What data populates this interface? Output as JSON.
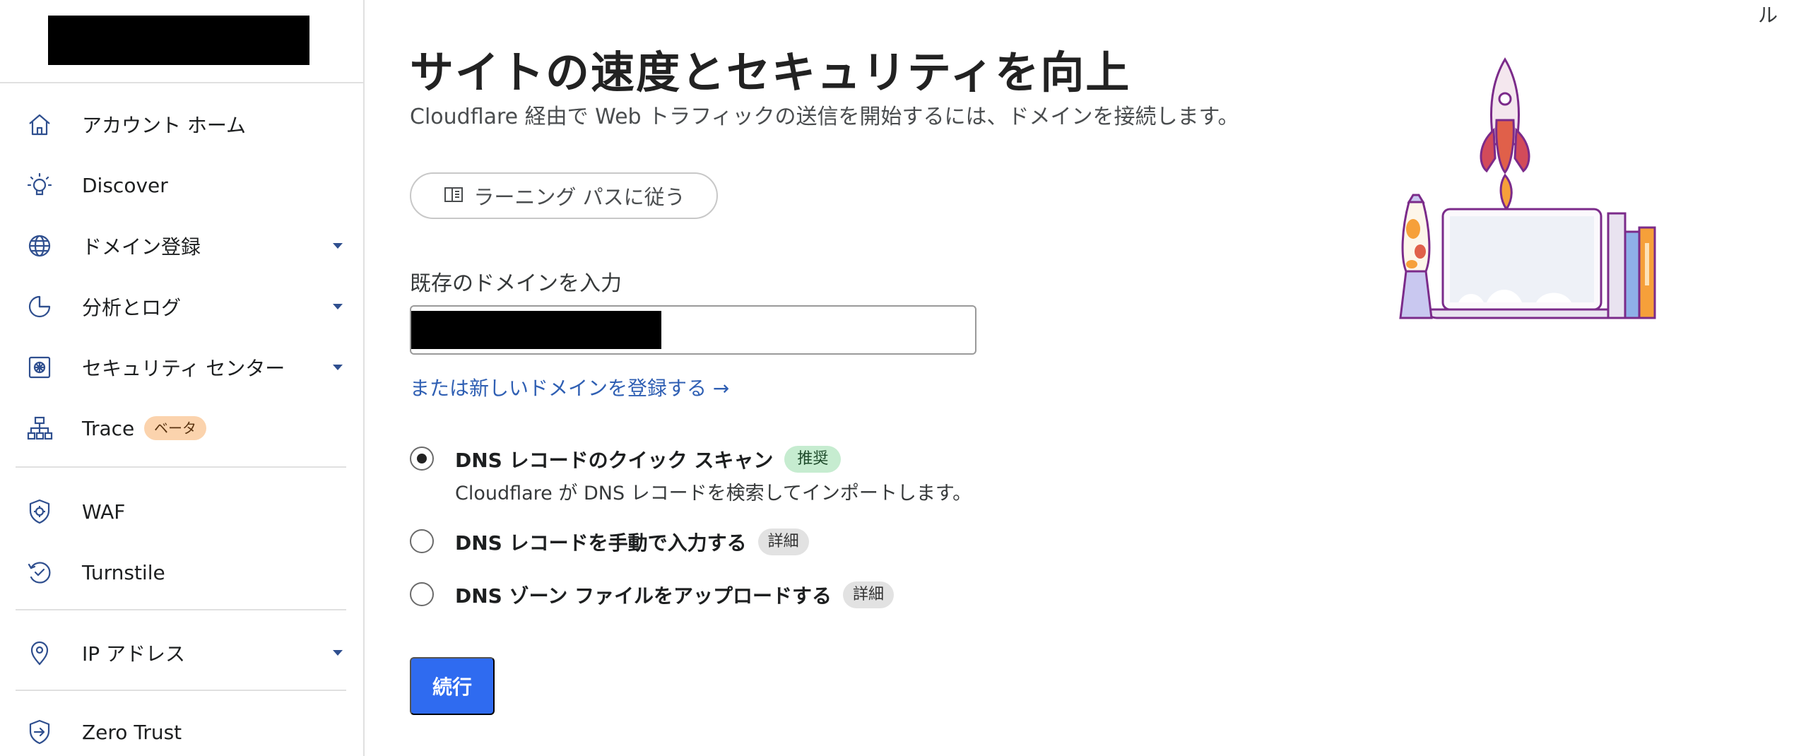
{
  "sidebar": {
    "items": [
      {
        "label": "アカウント ホーム",
        "icon": "home-icon"
      },
      {
        "label": "Discover",
        "icon": "lightbulb-icon"
      },
      {
        "label": "ドメイン登録",
        "icon": "globe-icon",
        "expandable": true
      },
      {
        "label": "分析とログ",
        "icon": "pie-chart-icon",
        "expandable": true
      },
      {
        "label": "セキュリティ センター",
        "icon": "security-center-icon",
        "expandable": true
      },
      {
        "label": "Trace",
        "icon": "sitemap-icon",
        "badge": "ベータ"
      },
      {
        "label": "WAF",
        "icon": "shield-gear-icon"
      },
      {
        "label": "Turnstile",
        "icon": "turnstile-icon"
      },
      {
        "label": "IP アドレス",
        "icon": "location-pin-icon",
        "expandable": true
      },
      {
        "label": "Zero Trust",
        "icon": "zero-trust-icon"
      }
    ]
  },
  "header": {
    "corner_text": "ル"
  },
  "main": {
    "title": "サイトの速度とセキュリティを向上",
    "description": "Cloudflare 経由で Web トラフィックの送信を開始するには、ドメインを接続します。",
    "learning_path_label": "ラーニング パスに従う",
    "domain_field_label": "既存のドメインを入力",
    "register_link": "または新しいドメインを登録する →",
    "options": [
      {
        "title": "DNS レコードのクイック スキャン",
        "badge": "推奨",
        "subtitle": "Cloudflare が DNS レコードを検索してインポートします。",
        "checked": true
      },
      {
        "title": "DNS レコードを手動で入力する",
        "badge": "詳細",
        "checked": false
      },
      {
        "title": "DNS ゾーン ファイルをアップロードする",
        "badge": "詳細",
        "checked": false
      }
    ],
    "continue_label": "続行"
  },
  "colors": {
    "accent": "#2f6bf0",
    "link": "#2f5fb3",
    "sidebar_icon": "#2f4f8f"
  }
}
